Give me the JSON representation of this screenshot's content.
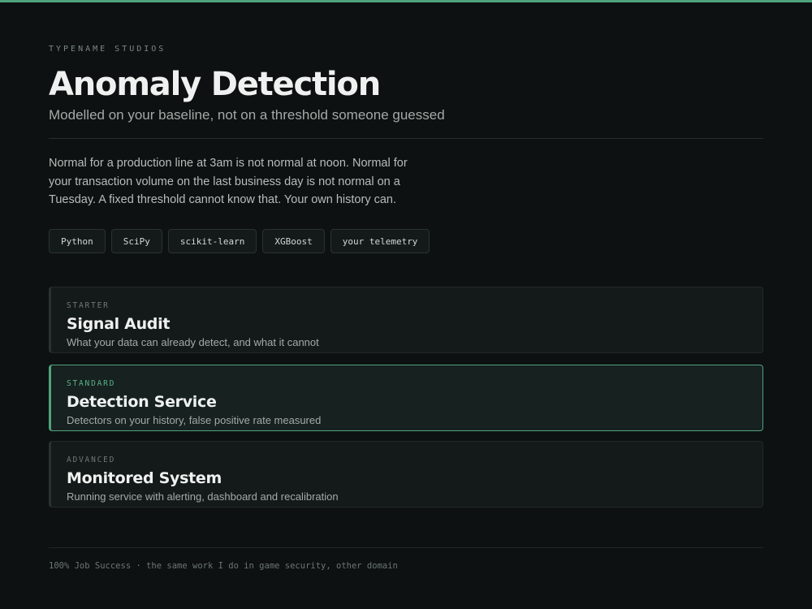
{
  "colors": {
    "accent": "#4fa37c",
    "background": "#0d1111"
  },
  "header": {
    "eyebrow": "TYPENAME STUDIOS",
    "title": "Anomaly Detection",
    "subtitle": "Modelled on your baseline, not on a threshold someone guessed"
  },
  "intro": "Normal for a production line at 3am is not normal at noon. Normal for your transaction volume on the last business day is not normal on a Tuesday. A fixed threshold cannot know that. Your own history can.",
  "tags": [
    "Python",
    "SciPy",
    "scikit-learn",
    "XGBoost",
    "your telemetry"
  ],
  "tiers": [
    {
      "tag": "STARTER",
      "name": "Signal Audit",
      "desc": "What your data can already detect, and what it cannot"
    },
    {
      "tag": "STANDARD",
      "name": "Detection Service",
      "desc": "Detectors on your history, false positive rate measured"
    },
    {
      "tag": "ADVANCED",
      "name": "Monitored System",
      "desc": "Running service with alerting, dashboard and recalibration"
    }
  ],
  "footer": "100% Job Success · the same work I do in game security, other domain"
}
